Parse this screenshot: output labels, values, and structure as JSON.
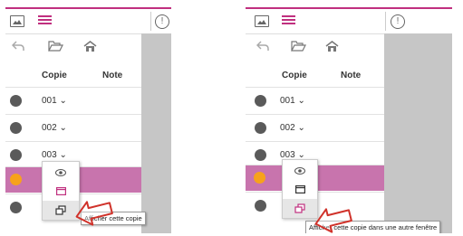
{
  "header": {
    "info_symbol": "!"
  },
  "toolbar": {
    "back_icon": "undo-icon",
    "folder_icon": "folder-open-icon",
    "home_icon": "home-icon"
  },
  "table": {
    "col_copie": "Copie",
    "col_note": "Note"
  },
  "rows": [
    {
      "copie": "001 ⌄"
    },
    {
      "copie": "002 ⌄"
    },
    {
      "copie": "003 ⌄"
    }
  ],
  "menu": {
    "view_icon": "eye-icon",
    "display_icon": "window-icon",
    "new_window_icon": "new-window-icon"
  },
  "tooltips": {
    "left": "Afficher cette copie",
    "right": "Afficher cette copie dans une autre fenêtre"
  },
  "colors": {
    "accent": "#c0307f",
    "highlight_row": "#c874ad",
    "active_dot": "#f7a21b",
    "dot": "#5a5a5a",
    "side_panel": "#c6c6c6"
  }
}
